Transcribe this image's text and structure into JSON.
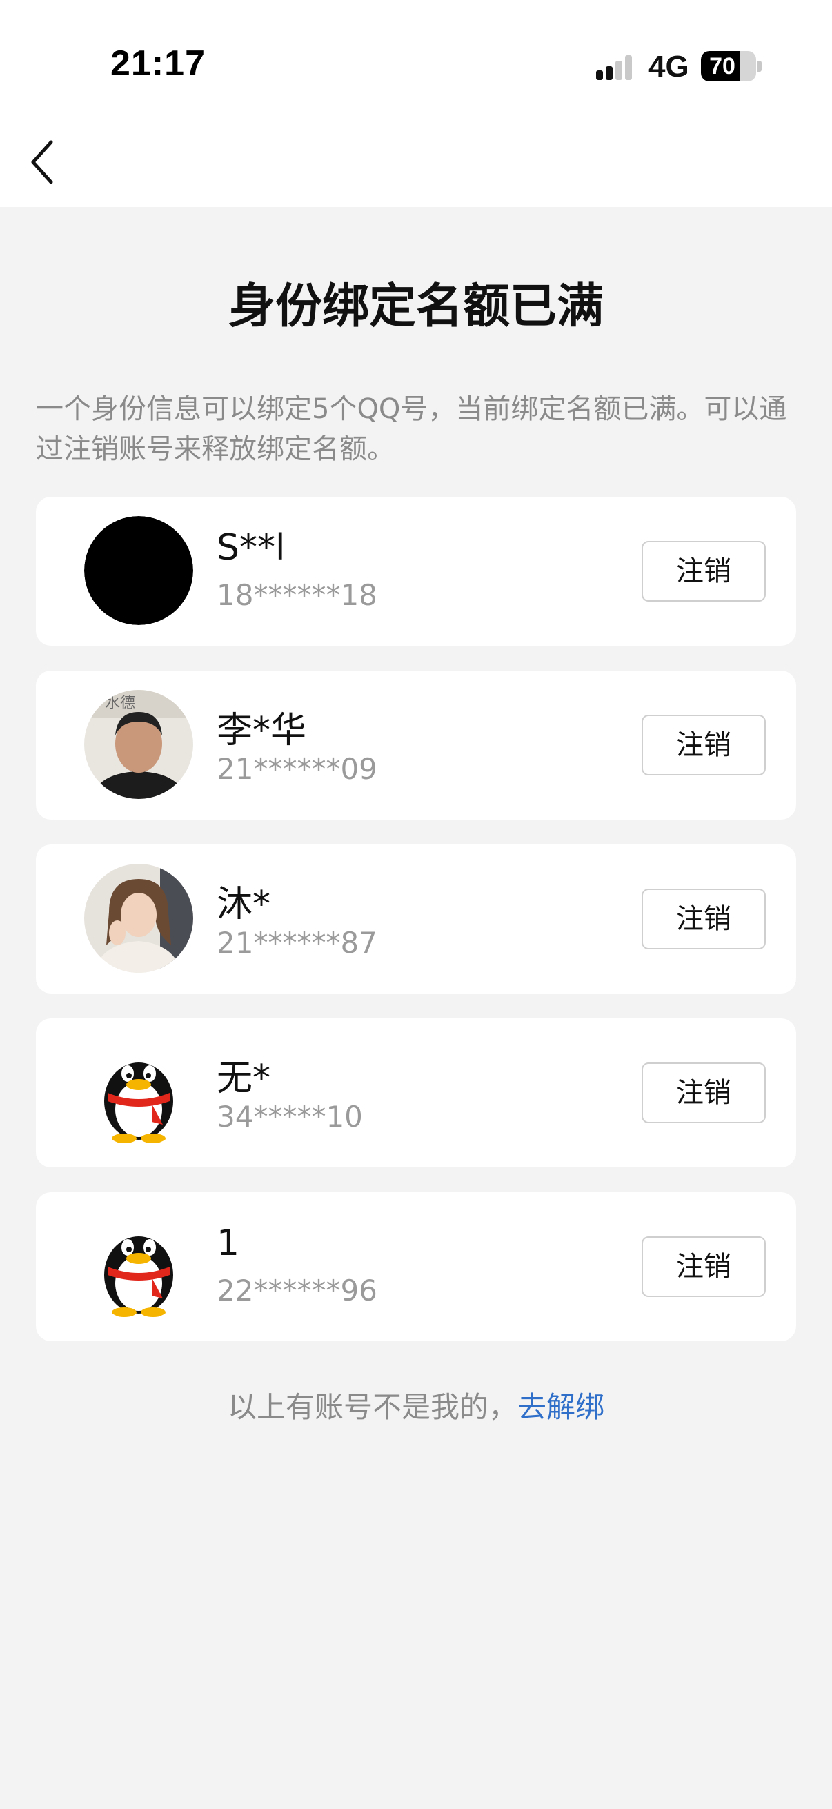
{
  "status_bar": {
    "time": "21:17",
    "network": "4G",
    "battery": "70",
    "battery_level": 0.7
  },
  "header": {
    "title": "身份绑定名额已满",
    "description": "一个身份信息可以绑定5个QQ号，当前绑定名额已满。可以通过注销账号来释放绑定名额。"
  },
  "accounts": [
    {
      "name": "S**l",
      "number": "18******18",
      "avatar": "black-circle-avatar",
      "action": "注销"
    },
    {
      "name": "李*华",
      "number": "21******09",
      "avatar": "man-photo-avatar",
      "action": "注销"
    },
    {
      "name": "沐*",
      "number": "21******87",
      "avatar": "woman-photo-avatar",
      "action": "注销"
    },
    {
      "name": "无*",
      "number": "34*****10",
      "avatar": "qq-penguin-avatar",
      "action": "注销"
    },
    {
      "name": "1",
      "number": "22******96",
      "avatar": "qq-penguin-avatar",
      "action": "注销"
    }
  ],
  "footer": {
    "text": "以上有账号不是我的，",
    "link": "去解绑"
  },
  "colors": {
    "background": "#f3f3f3",
    "card": "#ffffff",
    "link": "#2f6fca",
    "muted_text": "#8a8a8a"
  }
}
